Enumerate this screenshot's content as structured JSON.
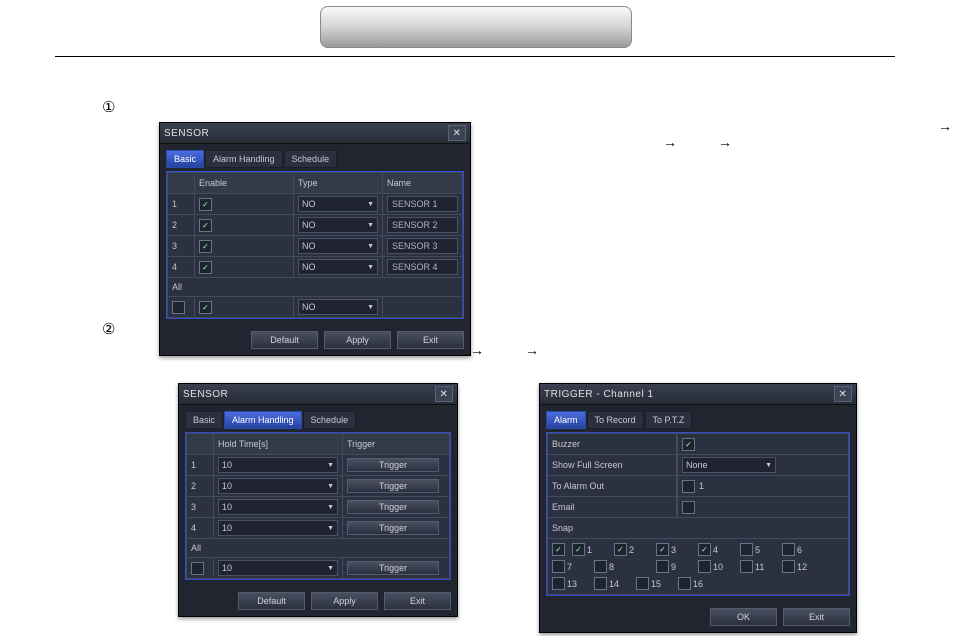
{
  "circled": {
    "one": "①",
    "two": "②"
  },
  "panelA": {
    "title": "SENSOR",
    "tabs": [
      "Basic",
      "Alarm Handling",
      "Schedule"
    ],
    "active_tab": 0,
    "headers": [
      "",
      "Enable",
      "Type",
      "Name"
    ],
    "rows": [
      {
        "idx": "1",
        "enable": true,
        "type": "NO",
        "name": "SENSOR 1"
      },
      {
        "idx": "2",
        "enable": true,
        "type": "NO",
        "name": "SENSOR 2"
      },
      {
        "idx": "3",
        "enable": true,
        "type": "NO",
        "name": "SENSOR 3"
      },
      {
        "idx": "4",
        "enable": true,
        "type": "NO",
        "name": "SENSOR 4"
      }
    ],
    "all_label": "All",
    "all_enable": true,
    "all_type": "NO",
    "buttons": [
      "Default",
      "Apply",
      "Exit"
    ]
  },
  "panelB": {
    "title": "SENSOR",
    "tabs": [
      "Basic",
      "Alarm Handling",
      "Schedule"
    ],
    "active_tab": 1,
    "headers": [
      "",
      "Hold Time[s]",
      "Trigger"
    ],
    "rows": [
      {
        "idx": "1",
        "hold": "10",
        "trigger": "Trigger"
      },
      {
        "idx": "2",
        "hold": "10",
        "trigger": "Trigger"
      },
      {
        "idx": "3",
        "hold": "10",
        "trigger": "Trigger"
      },
      {
        "idx": "4",
        "hold": "10",
        "trigger": "Trigger"
      }
    ],
    "all_label": "All",
    "all_hold": "10",
    "all_trigger": "Trigger",
    "buttons": [
      "Default",
      "Apply",
      "Exit"
    ]
  },
  "panelC": {
    "title": "TRIGGER - Channel 1",
    "tabs": [
      "Alarm",
      "To Record",
      "To P.T.Z"
    ],
    "active_tab": 0,
    "rows": {
      "buzzer_label": "Buzzer",
      "buzzer_checked": true,
      "full_label": "Show Full Screen",
      "full_value": "None",
      "alarmout_label": "To Alarm Out",
      "alarmout_checked": false,
      "alarmout_num": "1",
      "email_label": "Email",
      "email_checked": false,
      "snap_label": "Snap"
    },
    "snap_master_checked": true,
    "snap_items": [
      {
        "n": "1",
        "c": true
      },
      {
        "n": "2",
        "c": true
      },
      {
        "n": "3",
        "c": true
      },
      {
        "n": "4",
        "c": true
      },
      {
        "n": "5",
        "c": false
      },
      {
        "n": "6",
        "c": false
      },
      {
        "n": "7",
        "c": false
      },
      {
        "n": "8",
        "c": false
      },
      {
        "n": "9",
        "c": false
      },
      {
        "n": "10",
        "c": false
      },
      {
        "n": "11",
        "c": false
      },
      {
        "n": "12",
        "c": false
      },
      {
        "n": "13",
        "c": false
      },
      {
        "n": "14",
        "c": false
      },
      {
        "n": "15",
        "c": false
      },
      {
        "n": "16",
        "c": false
      }
    ],
    "buttons": [
      "OK",
      "Exit"
    ]
  }
}
